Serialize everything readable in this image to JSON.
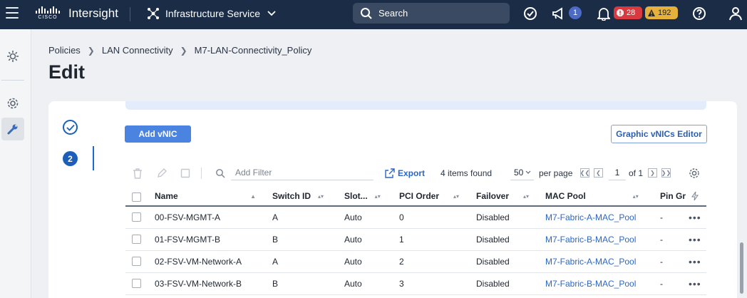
{
  "topbar": {
    "brand_word": "CISCO",
    "app_name": "Intersight",
    "service": "Infrastructure Service",
    "search_label": "Search",
    "notifications_count": "1",
    "critical_count": "28",
    "warning_count": "192"
  },
  "breadcrumb": {
    "items": [
      "Policies",
      "LAN Connectivity",
      "M7-LAN-Connectivity_Policy"
    ]
  },
  "page": {
    "title": "Edit"
  },
  "steps": {
    "current": "2"
  },
  "actions": {
    "add_vnic": "Add vNIC",
    "graphic_editor": "Graphic vNICs Editor"
  },
  "toolbar": {
    "filter_placeholder": "Add Filter",
    "export": "Export",
    "items_found": "4 items found",
    "per_page_value": "50",
    "per_page_label": "per page",
    "page_current": "1",
    "page_of": "of 1"
  },
  "table": {
    "columns": [
      "Name",
      "Switch ID",
      "Slot...",
      "PCI Order",
      "Failover",
      "MAC Pool",
      "Pin Gr"
    ],
    "rows": [
      {
        "name": "00-FSV-MGMT-A",
        "switch": "A",
        "slot": "Auto",
        "pci": "0",
        "failover": "Disabled",
        "mac_pool": "M7-Fabric-A-MAC_Pool",
        "pin": "-"
      },
      {
        "name": "01-FSV-MGMT-B",
        "switch": "B",
        "slot": "Auto",
        "pci": "1",
        "failover": "Disabled",
        "mac_pool": "M7-Fabric-B-MAC_Pool",
        "pin": "-"
      },
      {
        "name": "02-FSV-VM-Network-A",
        "switch": "A",
        "slot": "Auto",
        "pci": "2",
        "failover": "Disabled",
        "mac_pool": "M7-Fabric-A-MAC_Pool",
        "pin": "-"
      },
      {
        "name": "03-FSV-VM-Network-B",
        "switch": "B",
        "slot": "Auto",
        "pci": "3",
        "failover": "Disabled",
        "mac_pool": "M7-Fabric-B-MAC_Pool",
        "pin": "-"
      }
    ]
  },
  "colors": {
    "topbar": "#1b2c46",
    "primary": "#4a83e0",
    "link": "#2c67c5",
    "critical": "#d93a3f",
    "warning": "#e6b13a"
  }
}
